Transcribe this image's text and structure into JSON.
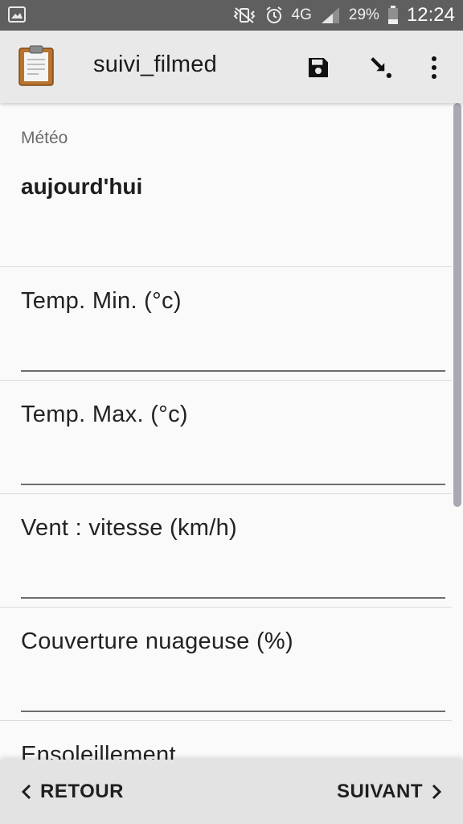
{
  "status_bar": {
    "network": "4G",
    "battery": "29%",
    "time": "12:24"
  },
  "app_bar": {
    "title": "suivi_filmed"
  },
  "form": {
    "group_label": "Météo",
    "group_value": "aujourd'hui",
    "fields": [
      {
        "label": "Temp. Min. (°c)",
        "value": ""
      },
      {
        "label": "Temp. Max. (°c)",
        "value": ""
      },
      {
        "label": "Vent : vitesse (km/h)",
        "value": ""
      },
      {
        "label": "Couverture nuageuse (%)",
        "value": ""
      },
      {
        "label": "Ensoleillement",
        "value": ""
      }
    ]
  },
  "nav": {
    "back_label": "RETOUR",
    "next_label": "SUIVANT"
  },
  "icons": {
    "app": "clipboard-icon",
    "save": "save-icon",
    "jump": "go-to-icon",
    "menu": "more-vert-icon"
  }
}
